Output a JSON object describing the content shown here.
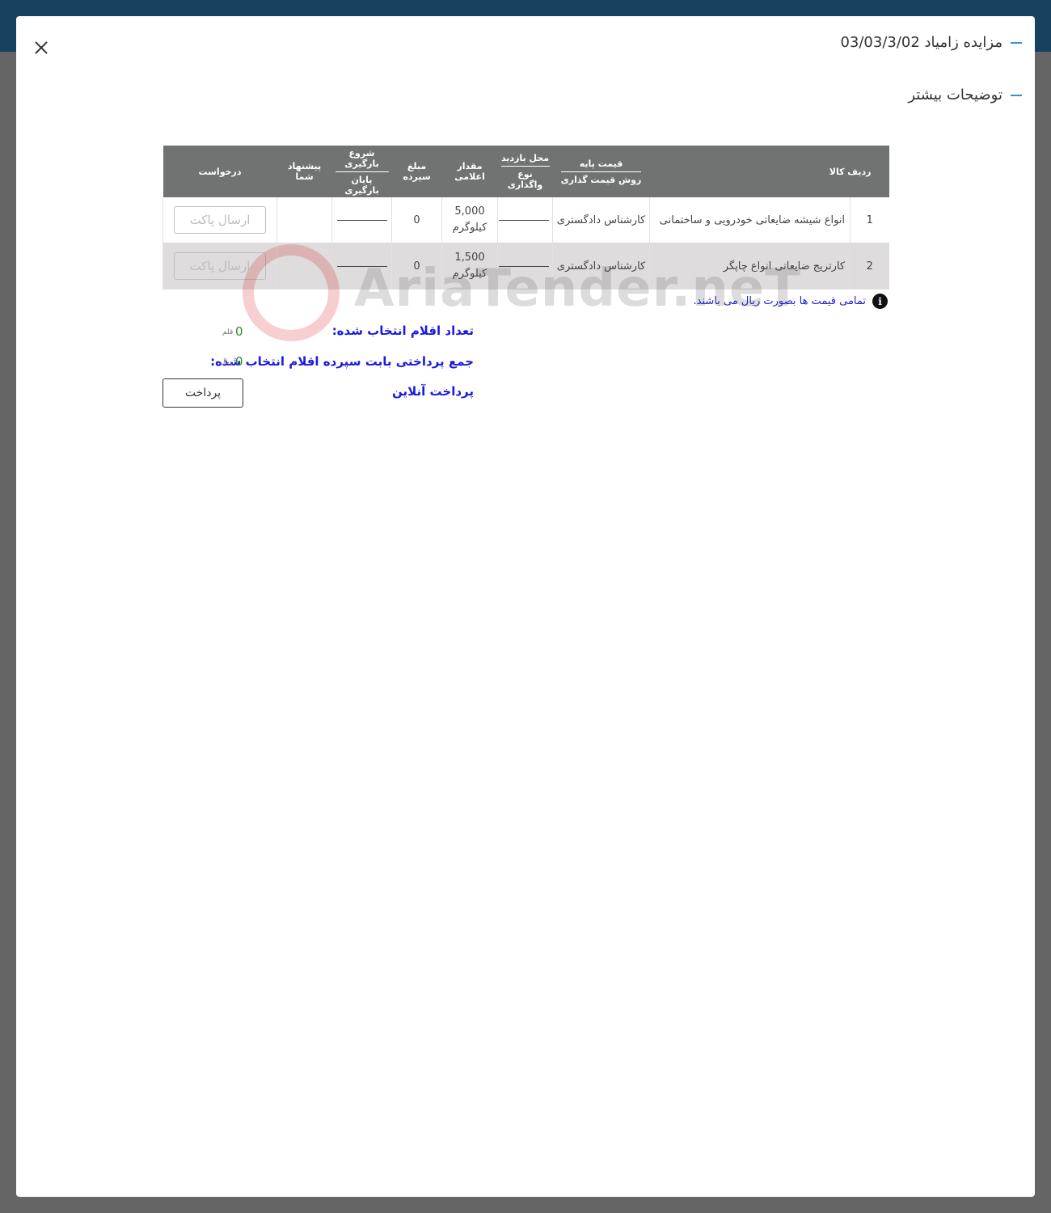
{
  "modal": {
    "title": "مزایده زامیاد 03/03/3/02",
    "subtitle": "توضیحات بیشتر"
  },
  "table": {
    "headers": {
      "row_item": "ردیف کالا",
      "base_price": "قیمت پایه",
      "pricing_method": "روش قیمت گذاری",
      "visit_place": "محل بازدید",
      "assignment_type": "نوع واگذاری",
      "quantity": "مقدار اعلامی",
      "deposit": "مبلغ سپرده",
      "loading_start": "شروع بارگیری",
      "loading_end": "پایان بارگیری",
      "your_offer": "پیشنهاد شما",
      "request": "درخواست"
    },
    "rows": [
      {
        "index": "1",
        "item": "انواع شیشه ضایعاتی خودرویی و ساختمانی",
        "pricing": "کارشناس دادگستری",
        "quantity": "5,000",
        "unit": "کیلوگرم",
        "deposit": "0",
        "button": "ارسال پاکت"
      },
      {
        "index": "2",
        "item": "کارتریج ضایعاتی انواع چاپگر",
        "pricing": "کارشناس دادگستری",
        "quantity": "1,500",
        "unit": "کیلوگرم",
        "deposit": "0",
        "button": "ارسال پاکت"
      }
    ]
  },
  "note": "تمامی قیمت ها بصورت ریال می باشند.",
  "watermark": "AriaTender.neT",
  "summary": {
    "selected_count_label": "تعداد اقلام انتخاب شده:",
    "selected_count_value": "0",
    "selected_count_unit": "قلم",
    "total_label": "جمع پرداختی بابت سپرده اقلام انتخاب شده:",
    "total_value": "0",
    "total_unit": "ریال",
    "online_payment_label": "پرداخت آنلاین",
    "pay_button": "پرداخت"
  },
  "colors": {
    "header_bg": "#717372",
    "label_blue": "#1a1ae0",
    "value_green": "#2d8a2d",
    "topbar": "#17425f"
  }
}
